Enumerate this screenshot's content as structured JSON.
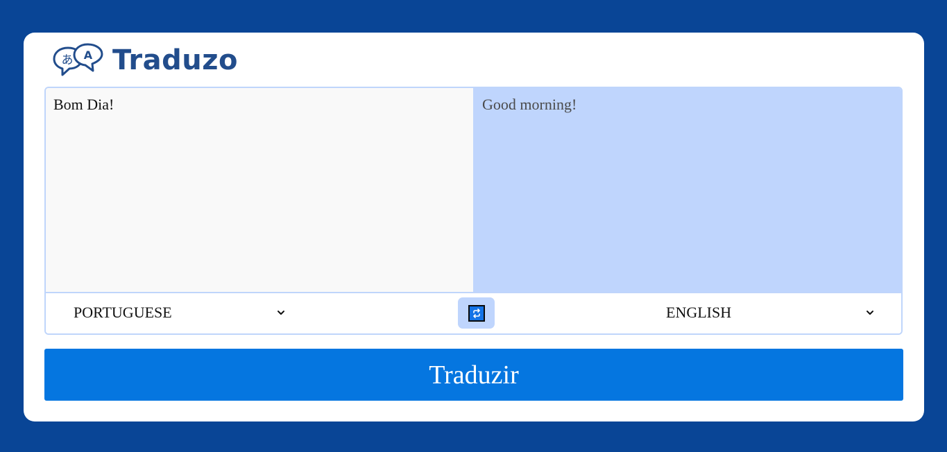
{
  "app": {
    "name": "Traduzo",
    "logo_icon": "translate-bubbles-icon",
    "logo_icon_glyphs": [
      "あ",
      "A"
    ]
  },
  "translator": {
    "source_text": "Bom Dia!",
    "translated_text": "Good morning!",
    "source_language": "PORTUGUESE",
    "target_language": "ENGLISH",
    "swap_icon": "swap-arrows-icon",
    "dropdown_icon": "chevron-down-icon"
  },
  "actions": {
    "translate_label": "Traduzir"
  },
  "colors": {
    "page_background": "#094596",
    "card_background": "#ffffff",
    "brand_text": "#224d8c",
    "source_pane": "#f9f9f9",
    "target_pane": "#bfd5fd",
    "border": "#bfd5fb",
    "primary_button": "#0576e0"
  }
}
